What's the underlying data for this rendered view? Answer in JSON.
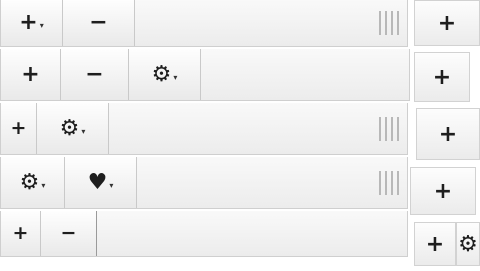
{
  "toolbars": [
    {
      "buttons": [
        {
          "glyph": "+",
          "caret": "▾"
        },
        {
          "glyph": "−"
        }
      ],
      "has_resize_grip": true
    },
    {
      "buttons": [
        {
          "glyph": "+"
        },
        {
          "glyph": "−"
        },
        {
          "glyph": "⚙",
          "caret": "▾"
        }
      ],
      "has_resize_grip": false
    },
    {
      "buttons": [
        {
          "glyph": "+"
        },
        {
          "glyph": "⚙",
          "caret": "▾"
        }
      ],
      "has_resize_grip": true
    },
    {
      "buttons": [
        {
          "glyph": "⚙",
          "caret": "▾"
        },
        {
          "glyph": "♥",
          "caret": "▾"
        }
      ],
      "has_resize_grip": true
    },
    {
      "buttons": [
        {
          "glyph": "+"
        },
        {
          "glyph": "−"
        }
      ],
      "has_resize_grip": false
    }
  ],
  "side_buttons": [
    {
      "glyph": "+"
    },
    {
      "glyph": "+"
    },
    {
      "glyph": "+"
    },
    {
      "glyph": "+"
    },
    {
      "glyph": "+"
    },
    {
      "glyph": "⚙"
    }
  ],
  "icons": {
    "plus": "plus-icon",
    "minus": "minus-icon",
    "gear": "gear-icon",
    "heart": "heart-icon",
    "caret": "caret-down-icon",
    "grip": "resize-grip-icon"
  }
}
